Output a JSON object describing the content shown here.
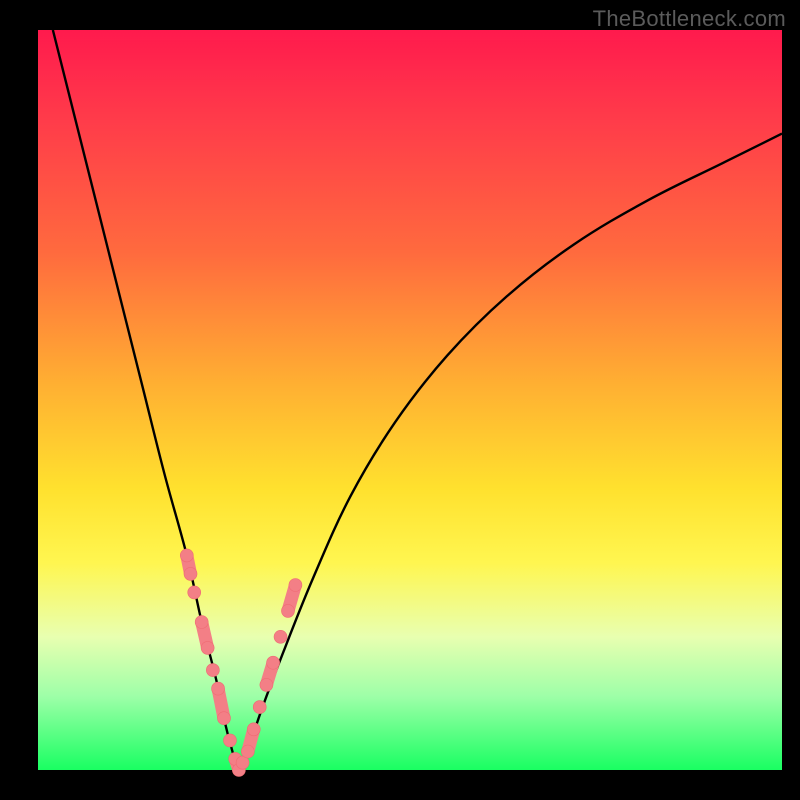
{
  "watermark": "TheBottleneck.com",
  "colors": {
    "frame": "#000000",
    "curve": "#000000",
    "marker_fill": "#f37f86",
    "marker_stroke": "#ef6b73",
    "gradient_stops": [
      "#ff1a4d",
      "#ff3b4a",
      "#ff6a3e",
      "#ffb032",
      "#ffe12e",
      "#fff650",
      "#e8ffb0",
      "#9effa8",
      "#19ff62"
    ]
  },
  "chart_data": {
    "type": "line",
    "title": "",
    "xlabel": "",
    "ylabel": "",
    "xlim": [
      0,
      100
    ],
    "ylim": [
      0,
      100
    ],
    "grid": false,
    "legend": false,
    "series": [
      {
        "name": "bottleneck-curve",
        "x": [
          2,
          5,
          8,
          11,
          14,
          17,
          20,
          22,
          24,
          25,
          26,
          27,
          28,
          30,
          33,
          37,
          42,
          48,
          55,
          63,
          72,
          82,
          92,
          100
        ],
        "y": [
          100,
          88,
          76,
          64,
          52,
          40,
          29,
          20,
          12,
          7,
          3,
          0,
          2,
          8,
          16,
          26,
          37,
          47,
          56,
          64,
          71,
          77,
          82,
          86
        ]
      }
    ],
    "markers": {
      "name": "highlighted-points",
      "x": [
        20.0,
        20.5,
        21.0,
        22.0,
        22.8,
        23.5,
        24.2,
        25.0,
        25.8,
        26.5,
        27.0,
        27.5,
        28.2,
        29.0,
        29.8,
        30.7,
        31.6,
        32.6,
        33.6,
        34.6
      ],
      "y": [
        29,
        26.5,
        24,
        20,
        16.5,
        13.5,
        11,
        7,
        4,
        1.5,
        0,
        1,
        2.5,
        5.5,
        8.5,
        11.5,
        14.5,
        18,
        21.5,
        25
      ]
    }
  }
}
